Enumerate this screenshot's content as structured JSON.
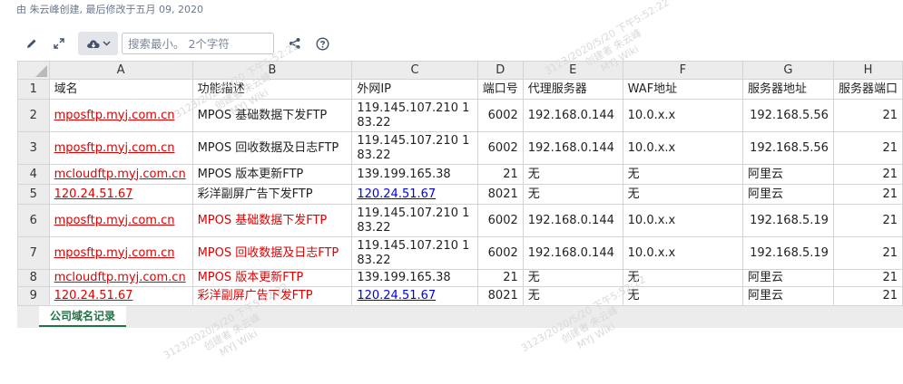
{
  "page_meta": "由 朱云峰创建, 最后修改于五月 09, 2020",
  "toolbar": {
    "search_placeholder": "搜索最小。 2个字符"
  },
  "columns": [
    "A",
    "B",
    "C",
    "D",
    "E",
    "F",
    "G",
    "H"
  ],
  "rows": [
    {
      "n": "1",
      "cells": [
        "域名",
        "功能描述",
        "外网IP",
        "端口号",
        "代理服务器",
        "WAF地址",
        "服务器地址",
        "服务器端口"
      ]
    },
    {
      "n": "2",
      "cells": [
        "mposftp.myj.com.cn",
        "MPOS 基础数据下发FTP",
        "119.145.107.210 183.22",
        "6002",
        "192.168.0.144",
        "10.0.x.x",
        "192.168.5.56",
        "21"
      ]
    },
    {
      "n": "3",
      "cells": [
        "mposftp.myj.com.cn",
        "MPOS 回收数据及日志FTP",
        "119.145.107.210 183.22",
        "6002",
        "192.168.0.144",
        "10.0.x.x",
        "192.168.5.56",
        "21"
      ]
    },
    {
      "n": "4",
      "cells": [
        "mcloudftp.myj.com.cn",
        "MPOS 版本更新FTP",
        "139.199.165.38",
        "21",
        "无",
        "无",
        "阿里云",
        "21"
      ]
    },
    {
      "n": "5",
      "cells": [
        "120.24.51.67",
        "彩洋副屏广告下发FTP",
        "120.24.51.67",
        "8021",
        "无",
        "无",
        "阿里云",
        "21"
      ]
    },
    {
      "n": "6",
      "cells": [
        "mposftp.myj.com.cn",
        "MPOS 基础数据下发FTP",
        "119.145.107.210 183.22",
        "6002",
        "192.168.0.144",
        "10.0.x.x",
        "192.168.5.19",
        "21"
      ]
    },
    {
      "n": "7",
      "cells": [
        "mposftp.myj.com.cn",
        "MPOS 回收数据及日志FTP",
        "119.145.107.210 183.22",
        "6002",
        "192.168.0.144",
        "10.0.x.x",
        "192.168.5.19",
        "21"
      ]
    },
    {
      "n": "8",
      "cells": [
        "mcloudftp.myj.com.cn",
        "MPOS 版本更新FTP",
        "139.199.165.38",
        "21",
        "无",
        "无",
        "阿里云",
        "21"
      ]
    },
    {
      "n": "9",
      "cells": [
        "120.24.51.67",
        "彩洋副屏广告下发FTP",
        "120.24.51.67",
        "8021",
        "无",
        "无",
        "阿里云",
        "21"
      ]
    }
  ],
  "sheet_tab": "公司域名记录",
  "watermark": {
    "line1": "3123/2020/5/20 下午5:52:22",
    "line2": "创建者 朱云峰",
    "line3": "MYJ Wiki"
  },
  "colors": {
    "link_red": "#e00000",
    "link_blue": "#0000ee",
    "tab_green": "#217346",
    "header_gray": "#ececec"
  }
}
